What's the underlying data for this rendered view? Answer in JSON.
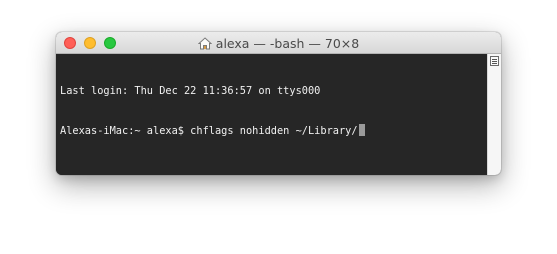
{
  "window": {
    "title": "alexa — -bash — 70×8",
    "title_icon": "home-icon"
  },
  "terminal": {
    "lines": [
      "Last login: Thu Dec 22 11:36:57 on ttys000",
      "Alexas-iMac:~ alexa$ chflags nohidden ~/Library/"
    ]
  },
  "colors": {
    "terminal_bg": "#262626",
    "terminal_text": "#f0f0f0",
    "close": "#ff5f57",
    "minimize": "#ffbd2e",
    "zoom": "#28c840"
  }
}
